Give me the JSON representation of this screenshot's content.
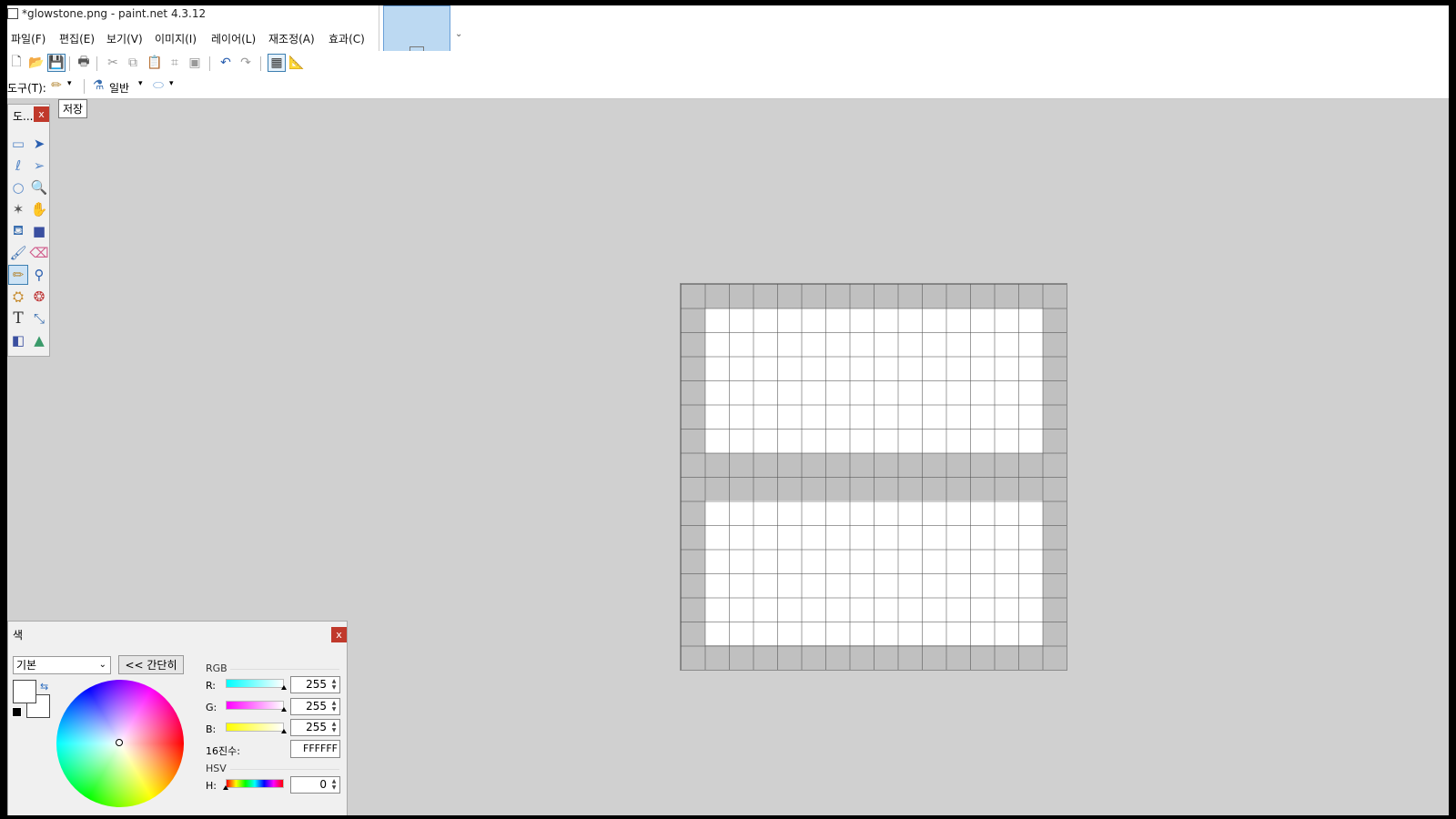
{
  "window": {
    "title": "*glowstone.png - paint.net 4.3.12"
  },
  "menu": [
    "파일(F)",
    "편집(E)",
    "보기(V)",
    "이미지(I)",
    "레이어(L)",
    "재조정(A)",
    "효과(C)"
  ],
  "toolbar2": {
    "tool_label": "도구(T):",
    "blend_mode": "일반"
  },
  "tooltip": "저장",
  "toolbox": {
    "title": "도...",
    "close": "x"
  },
  "color_panel": {
    "title": "색",
    "close": "x",
    "palette_select": "기본",
    "simple_button": "<< 간단히",
    "rgb_header": "RGB",
    "r_label": "R:",
    "r_value": "255",
    "g_label": "G:",
    "g_value": "255",
    "b_label": "B:",
    "b_value": "255",
    "hex_label": "16진수:",
    "hex_value": "FFFFFF",
    "hsv_header": "HSV",
    "h_label": "H:",
    "h_value": "0",
    "primary_color": "#FFFFFF",
    "secondary_color": "#FFFFFF"
  },
  "colors": {
    "canvas_border": "#C0C0C0",
    "canvas_fill": "#FFFFFF",
    "workspace": "#D0D0D0"
  }
}
